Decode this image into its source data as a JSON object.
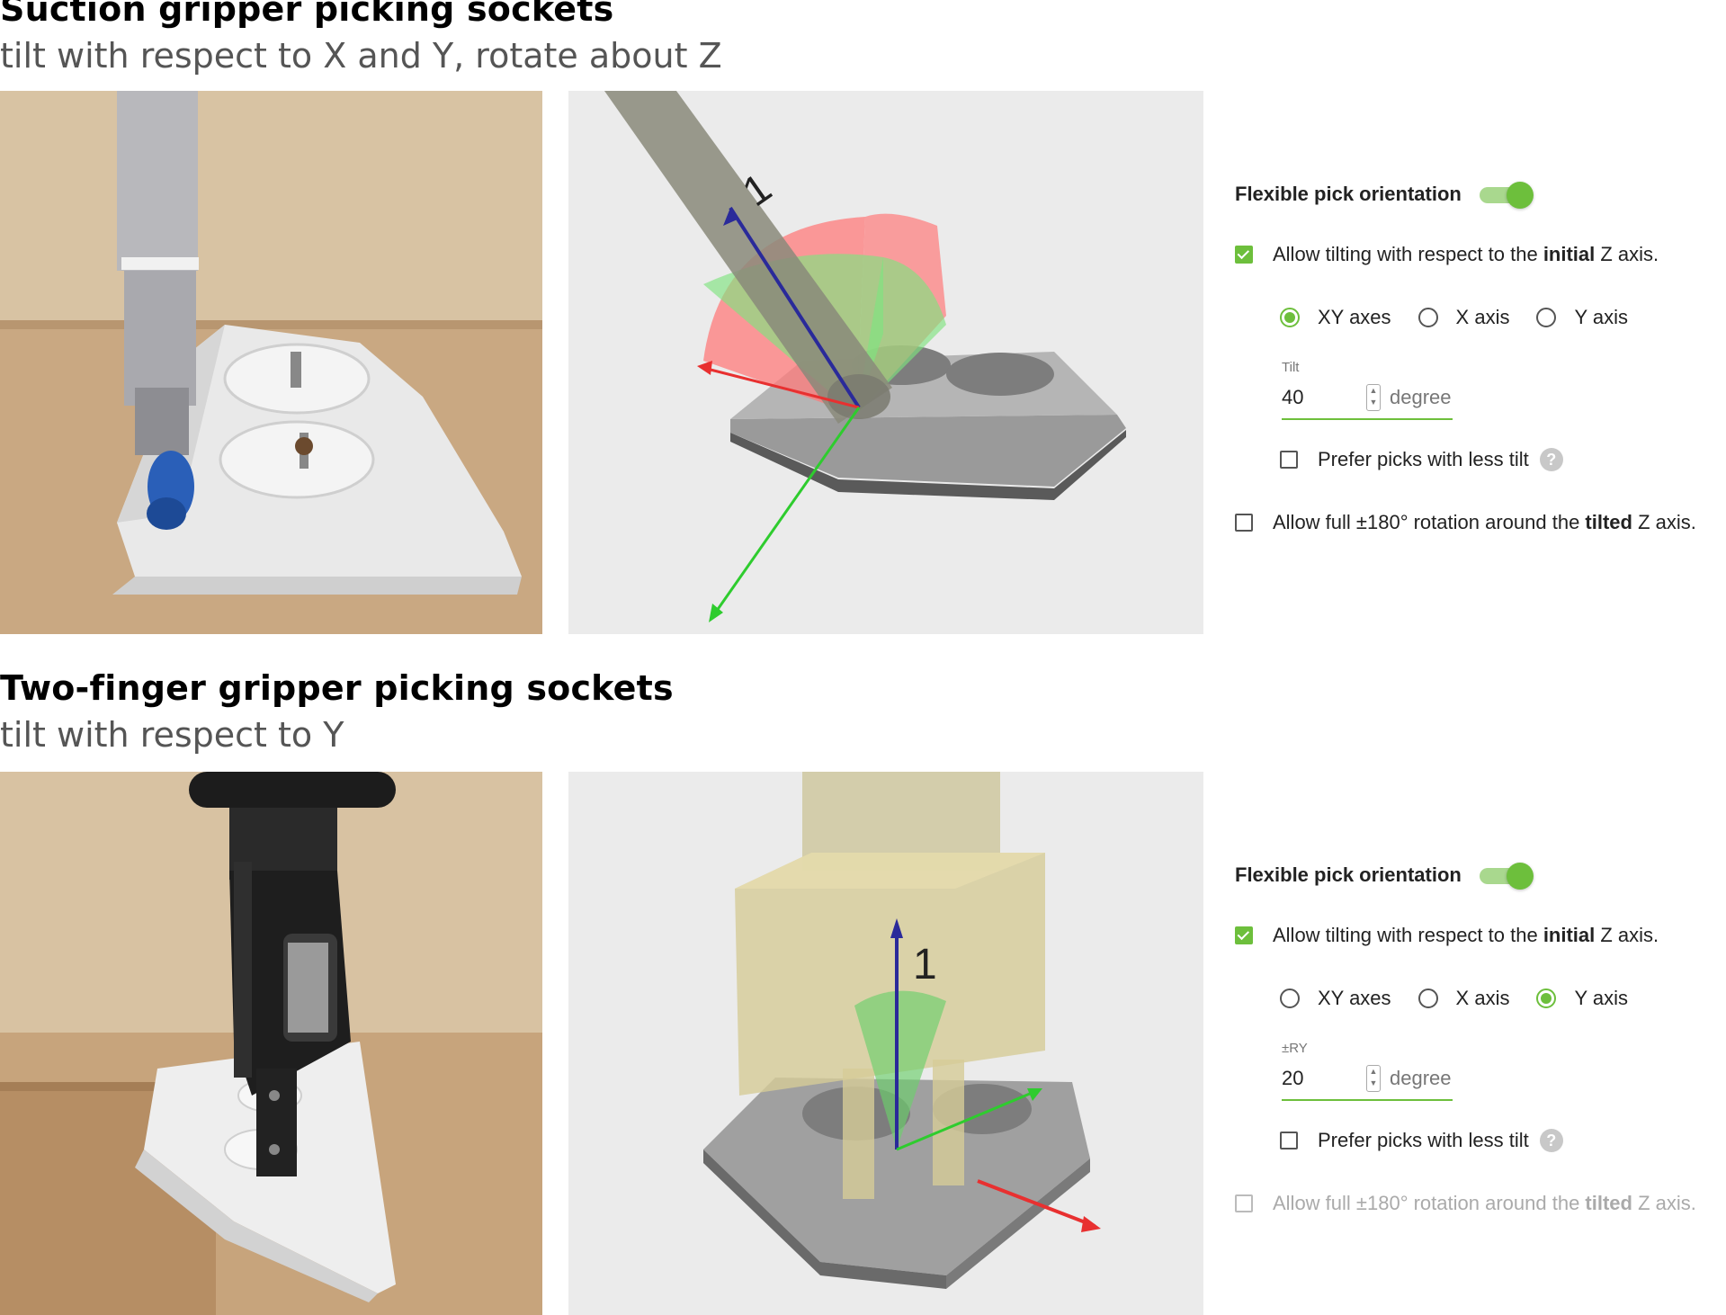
{
  "sections": [
    {
      "title": "Suction gripper picking sockets",
      "subtitle": "tilt with respect to X and Y, rotate about Z",
      "panel": {
        "flexible_label": "Flexible pick orientation",
        "flexible_on": true,
        "allow_tilt": {
          "pre": "Allow tilting with respect to the ",
          "bold": "initial",
          "post": " Z axis.",
          "checked": true
        },
        "axes": [
          {
            "label": "XY axes",
            "selected": true
          },
          {
            "label": "X axis",
            "selected": false
          },
          {
            "label": "Y axis",
            "selected": false
          }
        ],
        "field_label": "Tilt",
        "field_value": "40",
        "unit": "degree",
        "prefer_less_tilt": {
          "label": "Prefer picks with less tilt",
          "checked": false
        },
        "allow_rotation": {
          "pre": "Allow full ±180° rotation around the ",
          "bold": "tilted",
          "post": " Z axis.",
          "checked": false,
          "disabled": false
        }
      },
      "render_label": "1"
    },
    {
      "title": "Two-finger gripper picking sockets",
      "subtitle": "tilt with respect to Y",
      "panel": {
        "flexible_label": "Flexible pick orientation",
        "flexible_on": true,
        "allow_tilt": {
          "pre": "Allow tilting with respect to the ",
          "bold": "initial",
          "post": " Z axis.",
          "checked": true
        },
        "axes": [
          {
            "label": "XY axes",
            "selected": false
          },
          {
            "label": "X axis",
            "selected": false
          },
          {
            "label": "Y axis",
            "selected": true
          }
        ],
        "field_label": "±RY",
        "field_value": "20",
        "unit": "degree",
        "prefer_less_tilt": {
          "label": "Prefer picks with less tilt",
          "checked": false
        },
        "allow_rotation": {
          "pre": "Allow full ±180° rotation around the ",
          "bold": "tilted",
          "post": " Z axis.",
          "checked": false,
          "disabled": true
        }
      },
      "render_label": "1"
    }
  ],
  "colors": {
    "accent": "#6dbf3c",
    "render_bg": "#ebebeb",
    "axis_red": "#e83030",
    "axis_green": "#2ecc2e",
    "axis_blue": "#2a2a9a"
  },
  "icons": {
    "help": "help-circle-icon",
    "check": "check-icon"
  }
}
